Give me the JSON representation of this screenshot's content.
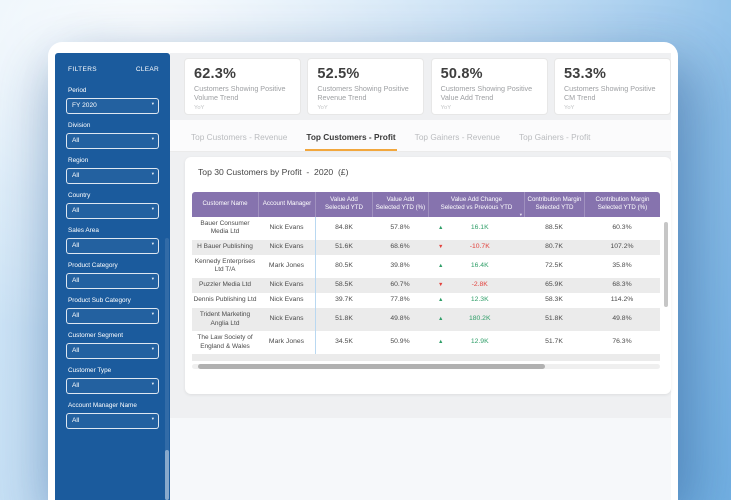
{
  "sidebar": {
    "title": "FILTERS",
    "clear_label": "CLEAR",
    "filters": [
      {
        "label": "Period",
        "value": "FY 2020"
      },
      {
        "label": "Division",
        "value": "All"
      },
      {
        "label": "Region",
        "value": "All"
      },
      {
        "label": "Country",
        "value": "All"
      },
      {
        "label": "Sales Area",
        "value": "All"
      },
      {
        "label": "Product Category",
        "value": "All"
      },
      {
        "label": "Product Sub Category",
        "value": "All"
      },
      {
        "label": "Customer Segment",
        "value": "All"
      },
      {
        "label": "Customer Type",
        "value": "All"
      },
      {
        "label": "Account Manager Name",
        "value": "All"
      }
    ]
  },
  "kpi_cards": [
    {
      "value": "62.3%",
      "label": "Customers Showing Positive Volume Trend",
      "period": "YoY"
    },
    {
      "value": "52.5%",
      "label": "Customers Showing Positive Revenue Trend",
      "period": "YoY"
    },
    {
      "value": "50.8%",
      "label": "Customers Showing Positive Value Add Trend",
      "period": "YoY"
    },
    {
      "value": "53.3%",
      "label": "Customers Showing Positive CM Trend",
      "period": "YoY"
    }
  ],
  "tabs": [
    {
      "label": "Top Customers - Revenue",
      "active": false
    },
    {
      "label": "Top Customers - Profit",
      "active": true
    },
    {
      "label": "Top Gainers - Revenue",
      "active": false
    },
    {
      "label": "Top Gainers - Profit",
      "active": false
    }
  ],
  "table": {
    "title": "Top 30 Customers by Profit  -  2020  (£)",
    "columns": [
      {
        "label": "Customer Name",
        "sorted": false
      },
      {
        "label": "Account Manager",
        "sorted": false
      },
      {
        "label": "Value Add\nSelected YTD",
        "sorted": false
      },
      {
        "label": "Value Add\nSelected YTD (%)",
        "sorted": false
      },
      {
        "label": "Value Add Change\nSelected vs Previous YTD",
        "sorted": true
      },
      {
        "label": "Contribution Margin\nSelected YTD",
        "sorted": false
      },
      {
        "label": "Contribution Margin\nSelected YTD (%)",
        "sorted": false
      }
    ],
    "rows": [
      {
        "name": "Bauer Consumer Media Ltd",
        "manager": "Nick Evans",
        "value_add_ytd": "84.8K",
        "value_add_pct": "57.8%",
        "change_dir": "up",
        "change": "16.1K",
        "cm_ytd": "88.5K",
        "cm_pct": "60.3%"
      },
      {
        "name": "H Bauer Publishing",
        "manager": "Nick Evans",
        "value_add_ytd": "51.6K",
        "value_add_pct": "68.6%",
        "change_dir": "down",
        "change": "-10.7K",
        "cm_ytd": "80.7K",
        "cm_pct": "107.2%"
      },
      {
        "name": "Kennedy Enterprises Ltd T/A",
        "manager": "Mark Jones",
        "value_add_ytd": "80.5K",
        "value_add_pct": "39.8%",
        "change_dir": "up",
        "change": "16.4K",
        "cm_ytd": "72.5K",
        "cm_pct": "35.8%"
      },
      {
        "name": "Puzzler Media Ltd",
        "manager": "Nick Evans",
        "value_add_ytd": "58.5K",
        "value_add_pct": "60.7%",
        "change_dir": "down",
        "change": "-2.8K",
        "cm_ytd": "65.9K",
        "cm_pct": "68.3%"
      },
      {
        "name": "Dennis Publishing Ltd",
        "manager": "Nick Evans",
        "value_add_ytd": "39.7K",
        "value_add_pct": "77.8%",
        "change_dir": "up",
        "change": "12.3K",
        "cm_ytd": "58.3K",
        "cm_pct": "114.2%"
      },
      {
        "name": "Trident Marketing Anglia Ltd",
        "manager": "Nick Evans",
        "value_add_ytd": "51.8K",
        "value_add_pct": "49.8%",
        "change_dir": "up",
        "change": "180.2K",
        "cm_ytd": "51.8K",
        "cm_pct": "49.8%"
      },
      {
        "name": "The Law Society of England & Wales",
        "manager": "Mark Jones",
        "value_add_ytd": "34.5K",
        "value_add_pct": "50.9%",
        "change_dir": "up",
        "change": "12.9K",
        "cm_ytd": "51.7K",
        "cm_pct": "76.3%"
      }
    ]
  },
  "icons": {
    "trend_up": "▲",
    "trend_down": "▼",
    "dropdown_caret": "▾",
    "sort_caret": "▾"
  },
  "colors": {
    "sidebar_blue": "#1B5B9D",
    "table_header_purple": "#8673AE",
    "positive_green": "#2F9E68",
    "negative_red": "#E2423D",
    "tab_accent_orange": "#F2A73D"
  }
}
